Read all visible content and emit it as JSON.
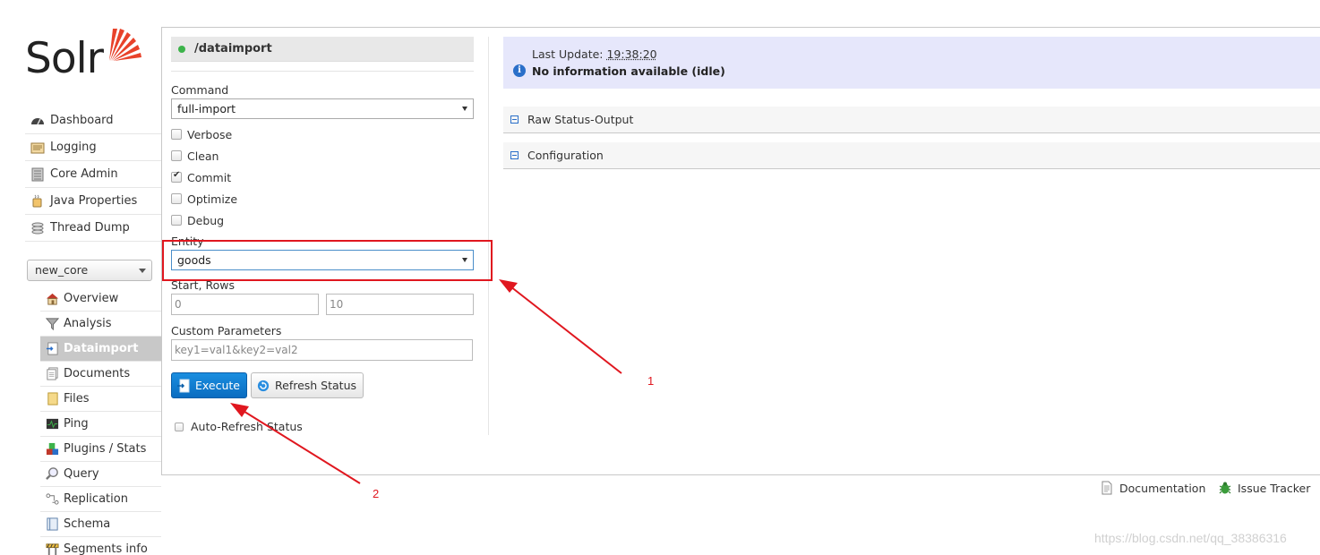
{
  "logo": {
    "text": "Solr"
  },
  "nav": [
    {
      "label": "Dashboard",
      "icon": "dashboard-icon"
    },
    {
      "label": "Logging",
      "icon": "logging-icon"
    },
    {
      "label": "Core Admin",
      "icon": "core-admin-icon"
    },
    {
      "label": "Java Properties",
      "icon": "java-icon"
    },
    {
      "label": "Thread Dump",
      "icon": "thread-dump-icon"
    }
  ],
  "core_selector": {
    "value": "new_core"
  },
  "core_nav": [
    {
      "label": "Overview",
      "icon": "home-icon"
    },
    {
      "label": "Analysis",
      "icon": "funnel-icon"
    },
    {
      "label": "Dataimport",
      "icon": "dataimport-icon",
      "active": true
    },
    {
      "label": "Documents",
      "icon": "documents-icon"
    },
    {
      "label": "Files",
      "icon": "files-icon"
    },
    {
      "label": "Ping",
      "icon": "ping-icon"
    },
    {
      "label": "Plugins / Stats",
      "icon": "plugins-icon"
    },
    {
      "label": "Query",
      "icon": "query-icon"
    },
    {
      "label": "Replication",
      "icon": "replication-icon"
    },
    {
      "label": "Schema",
      "icon": "schema-icon"
    },
    {
      "label": "Segments info",
      "icon": "segments-icon"
    }
  ],
  "form": {
    "header": "/dataimport",
    "command_label": "Command",
    "command_value": "full-import",
    "options": [
      {
        "label": "Verbose",
        "checked": false
      },
      {
        "label": "Clean",
        "checked": false
      },
      {
        "label": "Commit",
        "checked": true
      },
      {
        "label": "Optimize",
        "checked": false
      },
      {
        "label": "Debug",
        "checked": false
      }
    ],
    "entity_label": "Entity",
    "entity_value": "goods",
    "start_rows_label": "Start, Rows",
    "start_value": "0",
    "rows_value": "10",
    "custom_params_label": "Custom Parameters",
    "custom_params_placeholder": "key1=val1&key2=val2",
    "execute_label": "Execute",
    "refresh_label": "Refresh Status",
    "auto_refresh_label": "Auto-Refresh Status"
  },
  "status": {
    "last_update_label": "Last Update:",
    "last_update_time": "19:38:20",
    "message": "No information available (idle)"
  },
  "sections": [
    {
      "label": "Raw Status-Output"
    },
    {
      "label": "Configuration"
    }
  ],
  "footer": {
    "documentation": "Documentation",
    "issue_tracker": "Issue Tracker"
  },
  "watermark": "https://blog.csdn.net/qq_38386316",
  "annotations": {
    "one": "1",
    "two": "2"
  },
  "colors": {
    "annotation": "#e0171f",
    "primary_button": "#0a6cc0",
    "status_bg": "#e6e7fb"
  }
}
